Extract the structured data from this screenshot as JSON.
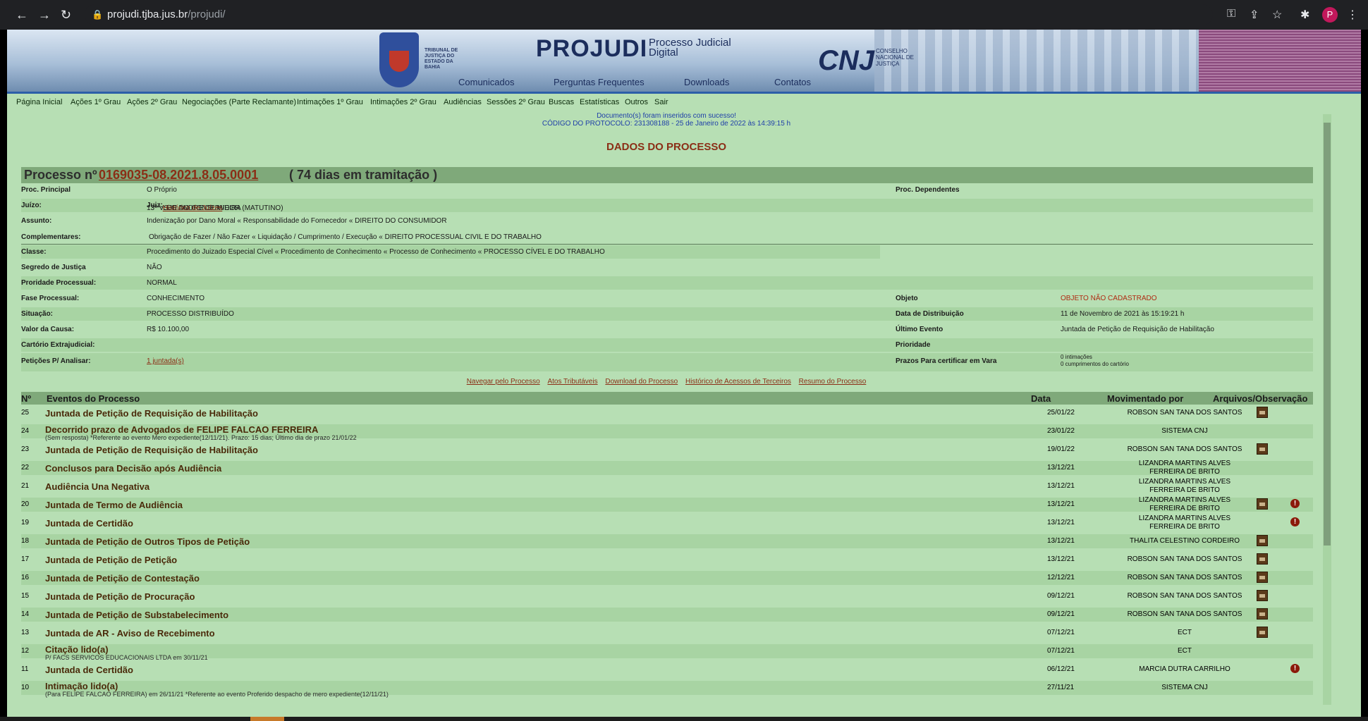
{
  "browser": {
    "url_host": "projudi.tjba.jus.br",
    "url_path": "/projudi/",
    "avatar_letter": "P"
  },
  "banner": {
    "tribunal_text": "TRIBUNAL DE JUSTIÇA DO ESTADO DA BAHIA",
    "brand": "PROJUDI",
    "brand_sub": "Processo Judicial Digital",
    "cnj": "CNJ",
    "cnj_sub": "CONSELHO NACIONAL DE JUSTIÇA",
    "nav": [
      "Comunicados",
      "Perguntas Frequentes",
      "Downloads",
      "Contatos"
    ]
  },
  "menu": [
    "Página Inicial",
    "Ações 1º Grau",
    "Ações 2º Grau",
    "Negociações (Parte Reclamante)",
    "Intimações 1º Grau",
    "Intimações 2º Grau",
    "Audiências",
    "Sessões 2º Grau",
    "Buscas",
    "Estatísticas",
    "Outros",
    "Sair"
  ],
  "message": {
    "line1": "Documento(s) foram inseridos com sucesso!",
    "line2": "CÓDIGO DO PROTOCOLO: 231308188 - 25 de Janeiro de 2022 às 14:39:15 h"
  },
  "page_title": "DADOS DO PROCESSO",
  "process": {
    "prefix": "Processo nº",
    "number": "0169035-08.2021.8.05.0001",
    "suffix": "( 74 dias em tramitação )"
  },
  "fields": {
    "principal_label": "Proc. Principal",
    "principal_value": "O Próprio",
    "dependentes_label": "Proc. Dependentes",
    "juizo_label": "Juízo:",
    "juizo_value": "13ª VSJE DO CONSUMIDOR (MATUTINO) ",
    "juiz_label": "Juiz:",
    "juiz_value": " LEO ANDRE CERVEIRA ",
    "historico_juizes": "Histórico de Juízes",
    "assunto_label": "Assunto:",
    "assunto_value": "Indenização por Dano Moral « Responsabilidade do Fornecedor « DIREITO DO CONSUMIDOR",
    "complementares_label": "Complementares:",
    "complementares_value": "Obrigação de Fazer / Não Fazer « Liquidação / Cumprimento / Execução « DIREITO PROCESSUAL CIVIL E DO TRABALHO",
    "classe_label": "Classe:",
    "classe_value": "Procedimento do Juizado Especial Cível « Procedimento de Conhecimento « Processo de Conhecimento « PROCESSO CÍVEL E DO TRABALHO",
    "segredo_label": "Segredo de Justiça",
    "segredo_value": "NÃO",
    "prioridade_proc_label": "Proridade Processual:",
    "prioridade_proc_value": "NORMAL",
    "fase_label": "Fase Processual:",
    "fase_value": "CONHECIMENTO",
    "objeto_label": "Objeto",
    "objeto_value": "OBJETO NÃO CADASTRADO",
    "situacao_label": "Situação:",
    "situacao_value": "PROCESSO DISTRIBUÍDO",
    "distribuicao_label": "Data de Distribuição",
    "distribuicao_value": "11 de Novembro de 2021 às 15:19:21 h",
    "valor_label": "Valor da Causa:",
    "valor_value": "R$ 10.100,00",
    "ultimo_label": "Último Evento",
    "ultimo_value": "Juntada de Petição de Requisição de Habilitação",
    "cartorio_label": "Cartório Extrajudicial:",
    "prioridade_label": "Prioridade",
    "peticoes_label": "Petições P/ Analisar:",
    "peticoes_value": "1 juntada(s)",
    "prazos_label": "Prazos Para certificar em Vara",
    "prazos_value1": "0 intimações",
    "prazos_value2": "0 cumprimentos do cartório"
  },
  "links": [
    "Navegar pelo Processo",
    "Atos Tributáveis",
    "Download do Processo",
    "Histórico de Acessos de Terceiros",
    "Resumo do Processo"
  ],
  "events_header": {
    "n": "Nº",
    "evento": "Eventos do Processo",
    "data": "Data",
    "mov": "Movimentado por",
    "arq": "Arquivos/Observação"
  },
  "events": [
    {
      "n": "25",
      "desc": "Juntada de Petição de Requisição de Habilitação",
      "sub": "",
      "date": "25/01/22",
      "mov": "ROBSON SAN TANA DOS SANTOS",
      "mov2": "",
      "file": true,
      "obs": false
    },
    {
      "n": "24",
      "desc": "Decorrido prazo de Advogados de FELIPE FALCAO FERREIRA",
      "sub": "(Sem resposta) *Referente ao evento Mero expediente(12/11/21). Prazo: 15 dias; Último dia de prazo 21/01/22",
      "date": "23/01/22",
      "mov": "SISTEMA CNJ",
      "mov2": "",
      "file": false,
      "obs": false
    },
    {
      "n": "23",
      "desc": "Juntada de Petição de Requisição de Habilitação",
      "sub": "",
      "date": "19/01/22",
      "mov": "ROBSON SAN TANA DOS SANTOS",
      "mov2": "",
      "file": true,
      "obs": false
    },
    {
      "n": "22",
      "desc": "Conclusos para Decisão após Audiência",
      "sub": "",
      "date": "13/12/21",
      "mov": "LIZANDRA MARTINS ALVES",
      "mov2": "FERREIRA DE BRITO",
      "file": false,
      "obs": false
    },
    {
      "n": "21",
      "desc": "Audiência Una Negativa",
      "sub": "",
      "date": "13/12/21",
      "mov": "LIZANDRA MARTINS ALVES",
      "mov2": "FERREIRA DE BRITO",
      "file": false,
      "obs": false
    },
    {
      "n": "20",
      "desc": "Juntada de Termo de Audiência",
      "sub": "",
      "date": "13/12/21",
      "mov": "LIZANDRA MARTINS ALVES",
      "mov2": "FERREIRA DE BRITO",
      "file": true,
      "obs": true
    },
    {
      "n": "19",
      "desc": "Juntada de Certidão",
      "sub": "",
      "date": "13/12/21",
      "mov": "LIZANDRA MARTINS ALVES",
      "mov2": "FERREIRA DE BRITO",
      "file": false,
      "obs": true
    },
    {
      "n": "18",
      "desc": "Juntada de Petição de Outros Tipos de Petição",
      "sub": "",
      "date": "13/12/21",
      "mov": "THALITA CELESTINO CORDEIRO",
      "mov2": "",
      "file": true,
      "obs": false
    },
    {
      "n": "17",
      "desc": "Juntada de Petição de Petição",
      "sub": "",
      "date": "13/12/21",
      "mov": "ROBSON SAN TANA DOS SANTOS",
      "mov2": "",
      "file": true,
      "obs": false
    },
    {
      "n": "16",
      "desc": "Juntada de Petição de Contestação",
      "sub": "",
      "date": "12/12/21",
      "mov": "ROBSON SAN TANA DOS SANTOS",
      "mov2": "",
      "file": true,
      "obs": false
    },
    {
      "n": "15",
      "desc": "Juntada de Petição de Procuração",
      "sub": "",
      "date": "09/12/21",
      "mov": "ROBSON SAN TANA DOS SANTOS",
      "mov2": "",
      "file": true,
      "obs": false
    },
    {
      "n": "14",
      "desc": "Juntada de Petição de Substabelecimento",
      "sub": "",
      "date": "09/12/21",
      "mov": "ROBSON SAN TANA DOS SANTOS",
      "mov2": "",
      "file": true,
      "obs": false
    },
    {
      "n": "13",
      "desc": "Juntada de AR - Aviso de Recebimento",
      "sub": "",
      "date": "07/12/21",
      "mov": "ECT",
      "mov2": "",
      "file": true,
      "obs": false
    },
    {
      "n": "12",
      "desc": "Citação lido(a)",
      "sub": "P/ FACS SERVICOS EDUCACIONAIS LTDA em 30/11/21",
      "date": "07/12/21",
      "mov": "ECT",
      "mov2": "",
      "file": false,
      "obs": false
    },
    {
      "n": "11",
      "desc": "Juntada de Certidão",
      "sub": "",
      "date": "06/12/21",
      "mov": "MARCIA DUTRA CARRILHO",
      "mov2": "",
      "file": false,
      "obs": true
    },
    {
      "n": "10",
      "desc": "Intimação lido(a)",
      "sub": "(Para FELIPE FALCAO FERREIRA) em 26/11/21 *Referente ao evento Proferido despacho de mero expediente(12/11/21)",
      "date": "27/11/21",
      "mov": "SISTEMA CNJ",
      "mov2": "",
      "file": false,
      "obs": false
    }
  ]
}
